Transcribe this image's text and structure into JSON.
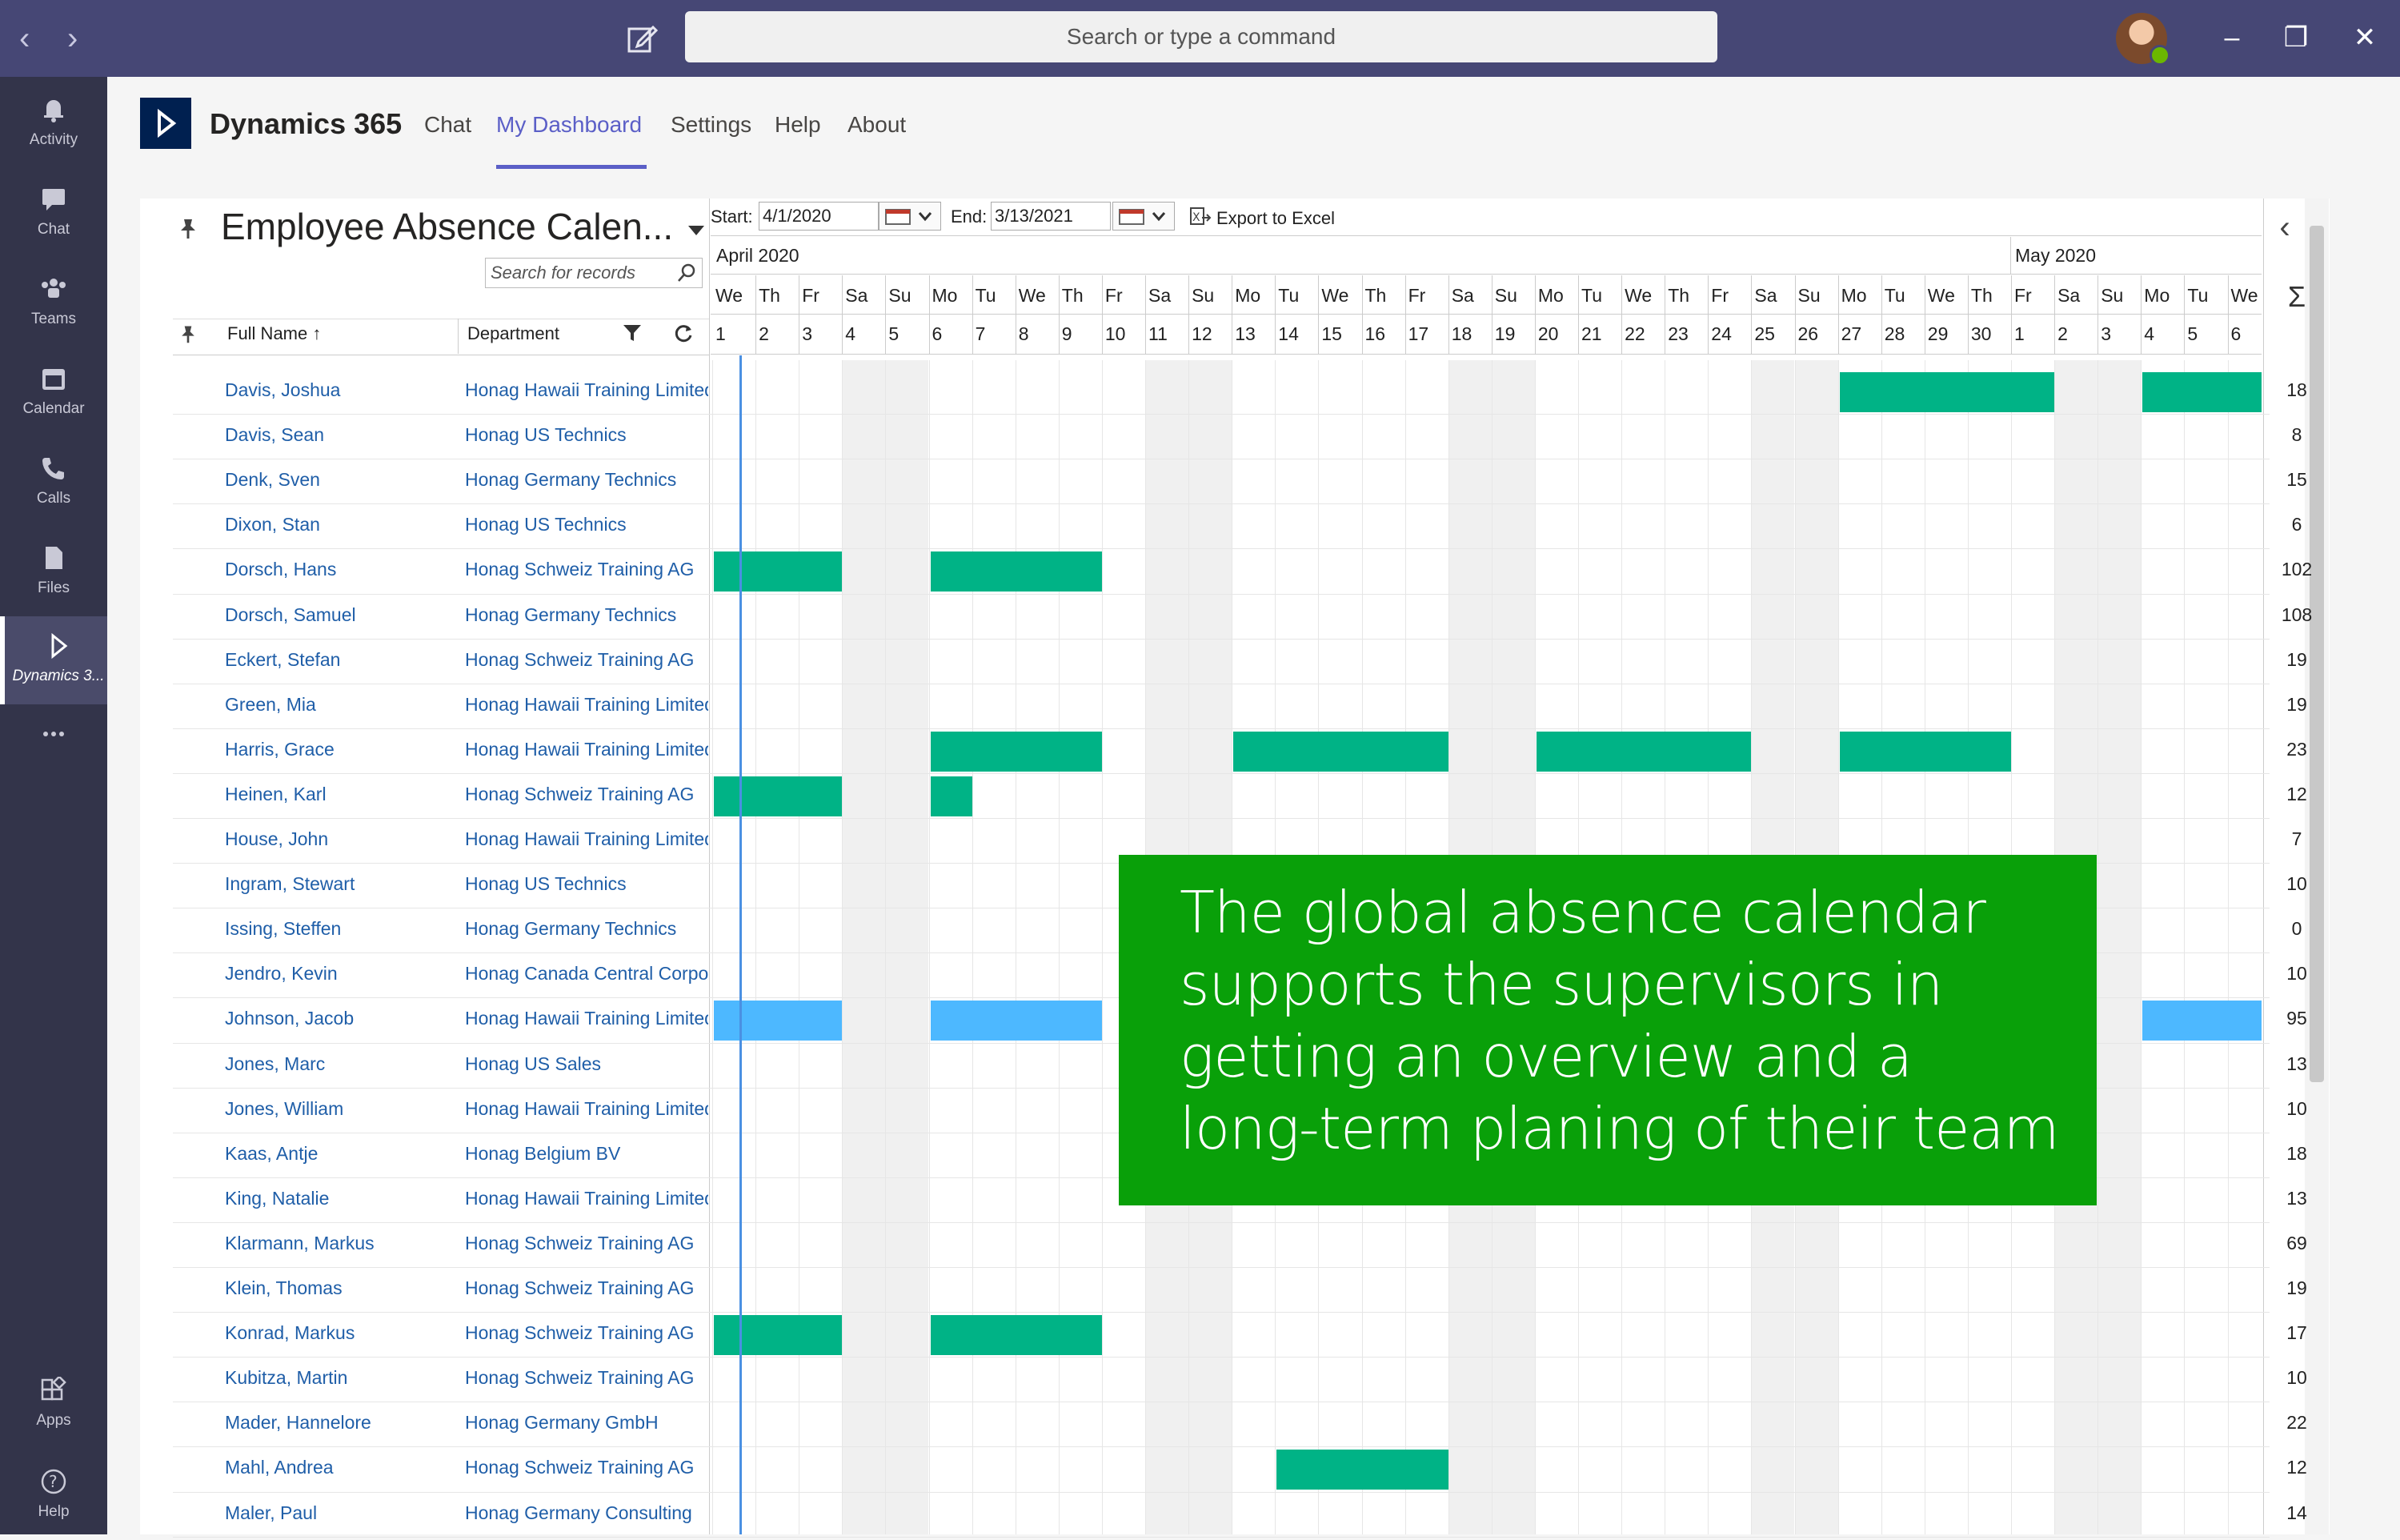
{
  "titlebar": {
    "search_placeholder": "Search or type a command"
  },
  "rail": [
    {
      "label": "Activity",
      "icon": "bell-icon"
    },
    {
      "label": "Chat",
      "icon": "chat-icon"
    },
    {
      "label": "Teams",
      "icon": "teams-icon"
    },
    {
      "label": "Calendar",
      "icon": "calendar-icon"
    },
    {
      "label": "Calls",
      "icon": "phone-icon"
    },
    {
      "label": "Files",
      "icon": "file-icon"
    },
    {
      "label": "Dynamics 3...",
      "icon": "dynamics-icon",
      "active": true
    },
    {
      "label": "",
      "icon": "more-icon"
    },
    {
      "label": "Apps",
      "icon": "apps-icon"
    },
    {
      "label": "Help",
      "icon": "help-icon"
    }
  ],
  "app": {
    "title": "Dynamics 365",
    "tabs": [
      "Chat",
      "My Dashboard",
      "Settings",
      "Help",
      "About"
    ],
    "active_tab": "My Dashboard"
  },
  "view": {
    "title": "Employee Absence Calen...",
    "search_placeholder": "Search for records",
    "start_label": "Start:",
    "start_value": "4/1/2020",
    "end_label": "End:",
    "end_value": "3/13/2021",
    "export_label": "Export to Excel",
    "col_fullname": "Full Name ↑",
    "col_department": "Department",
    "sum_symbol": "Σ"
  },
  "calendar": {
    "months": [
      "April 2020",
      "May 2020"
    ],
    "daynames": [
      "We",
      "Th",
      "Fr",
      "Sa",
      "Su",
      "Mo",
      "Tu",
      "We",
      "Th",
      "Fr",
      "Sa",
      "Su",
      "Mo",
      "Tu",
      "We",
      "Th",
      "Fr",
      "Sa",
      "Su",
      "Mo",
      "Tu",
      "We",
      "Th",
      "Fr",
      "Sa",
      "Su",
      "Mo",
      "Tu",
      "We",
      "Th",
      "Fr",
      "Sa",
      "Su",
      "Mo",
      "Tu",
      "We"
    ],
    "daynums": [
      "1",
      "2",
      "3",
      "4",
      "5",
      "6",
      "7",
      "8",
      "9",
      "10",
      "11",
      "12",
      "13",
      "14",
      "15",
      "16",
      "17",
      "18",
      "19",
      "20",
      "21",
      "22",
      "23",
      "24",
      "25",
      "26",
      "27",
      "28",
      "29",
      "30",
      "1",
      "2",
      "3",
      "4",
      "5",
      "6"
    ]
  },
  "rows": [
    {
      "name": "Davis, Joshua",
      "dept": "Honag Hawaii Training Limited",
      "sum": "18"
    },
    {
      "name": "Davis, Sean",
      "dept": "Honag US Technics",
      "sum": "8"
    },
    {
      "name": "Denk, Sven",
      "dept": "Honag Germany Technics",
      "sum": "15"
    },
    {
      "name": "Dixon, Stan",
      "dept": "Honag US Technics",
      "sum": "6"
    },
    {
      "name": "Dorsch, Hans",
      "dept": "Honag Schweiz Training AG",
      "sum": "102"
    },
    {
      "name": "Dorsch, Samuel",
      "dept": "Honag Germany Technics",
      "sum": "108"
    },
    {
      "name": "Eckert, Stefan",
      "dept": "Honag Schweiz Training AG",
      "sum": "19"
    },
    {
      "name": "Green, Mia",
      "dept": "Honag Hawaii Training Limited",
      "sum": "19"
    },
    {
      "name": "Harris, Grace",
      "dept": "Honag Hawaii Training Limited",
      "sum": "23"
    },
    {
      "name": "Heinen, Karl",
      "dept": "Honag Schweiz Training AG",
      "sum": "12"
    },
    {
      "name": "House, John",
      "dept": "Honag Hawaii Training Limited",
      "sum": "7"
    },
    {
      "name": "Ingram, Stewart",
      "dept": "Honag US Technics",
      "sum": "10"
    },
    {
      "name": "Issing, Steffen",
      "dept": "Honag Germany Technics",
      "sum": "0"
    },
    {
      "name": "Jendro, Kevin",
      "dept": "Honag Canada Central Corporation",
      "sum": "10"
    },
    {
      "name": "Johnson, Jacob",
      "dept": "Honag Hawaii Training Limited",
      "sum": "95"
    },
    {
      "name": "Jones, Marc",
      "dept": "Honag US Sales",
      "sum": "13"
    },
    {
      "name": "Jones, William",
      "dept": "Honag Hawaii Training Limited",
      "sum": "10"
    },
    {
      "name": "Kaas, Antje",
      "dept": "Honag Belgium BV",
      "sum": "18"
    },
    {
      "name": "King, Natalie",
      "dept": "Honag Hawaii Training Limited",
      "sum": "13"
    },
    {
      "name": "Klarmann, Markus",
      "dept": "Honag Schweiz Training AG",
      "sum": "69"
    },
    {
      "name": "Klein, Thomas",
      "dept": "Honag Schweiz Training AG",
      "sum": "19"
    },
    {
      "name": "Konrad, Markus",
      "dept": "Honag Schweiz Training AG",
      "sum": "17"
    },
    {
      "name": "Kubitza, Martin",
      "dept": "Honag Schweiz Training AG",
      "sum": "10"
    },
    {
      "name": "Mader, Hannelore",
      "dept": "Honag Germany GmbH",
      "sum": "22"
    },
    {
      "name": "Mahl, Andrea",
      "dept": "Honag Schweiz Training AG",
      "sum": "12"
    },
    {
      "name": "Maler, Paul",
      "dept": "Honag Germany Consulting",
      "sum": "14"
    }
  ],
  "absences": [
    {
      "row": 0,
      "start": 26,
      "days": 5,
      "color": "#00b386"
    },
    {
      "row": 0,
      "start": 33,
      "days": 3,
      "color": "#00b386"
    },
    {
      "row": 4,
      "start": 0,
      "days": 3,
      "color": "#00b386"
    },
    {
      "row": 4,
      "start": 5,
      "days": 4,
      "color": "#00b386"
    },
    {
      "row": 8,
      "start": 5,
      "days": 4,
      "color": "#00b386"
    },
    {
      "row": 8,
      "start": 12,
      "days": 5,
      "color": "#00b386"
    },
    {
      "row": 8,
      "start": 19,
      "days": 5,
      "color": "#00b386"
    },
    {
      "row": 8,
      "start": 26,
      "days": 4,
      "color": "#00b386"
    },
    {
      "row": 9,
      "start": 0,
      "days": 3,
      "color": "#00b386"
    },
    {
      "row": 9,
      "start": 5,
      "days": 1,
      "color": "#00b386"
    },
    {
      "row": 14,
      "start": 0,
      "days": 3,
      "color": "#4db8ff"
    },
    {
      "row": 14,
      "start": 5,
      "days": 4,
      "color": "#4db8ff"
    },
    {
      "row": 14,
      "start": 33,
      "days": 3,
      "color": "#4db8ff"
    },
    {
      "row": 21,
      "start": 0,
      "days": 3,
      "color": "#00b386"
    },
    {
      "row": 21,
      "start": 5,
      "days": 4,
      "color": "#00b386"
    },
    {
      "row": 24,
      "start": 13,
      "days": 4,
      "color": "#00b386"
    }
  ],
  "overlay": {
    "lines": [
      "The global absence calendar",
      "supports the supervisors in",
      "getting an overview and a",
      "long-term planing of their team"
    ]
  }
}
